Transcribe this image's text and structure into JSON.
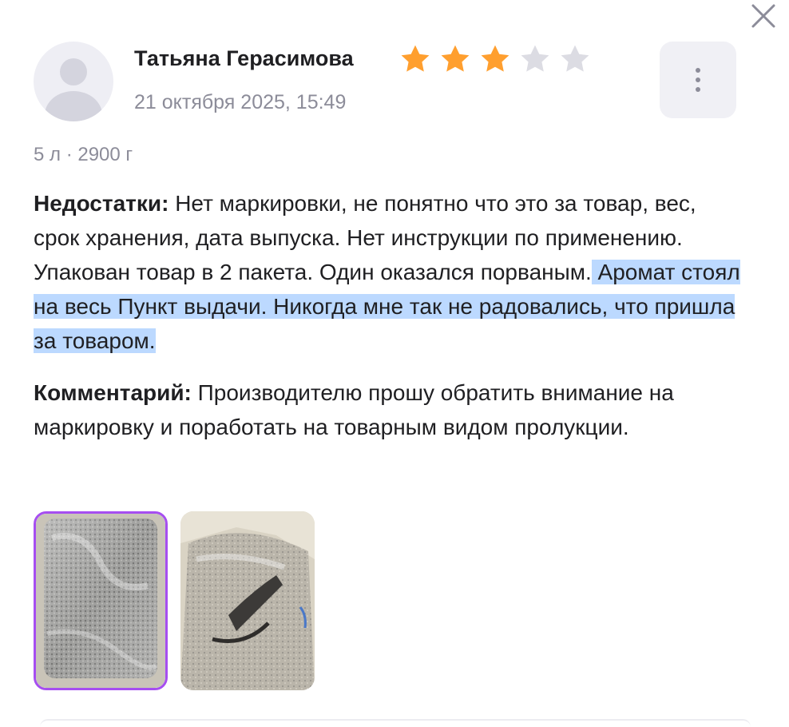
{
  "review": {
    "author": "Татьяна Герасимова",
    "date": "21 октября 2025, 15:49",
    "rating": 3,
    "rating_max": 5,
    "variant": "5 л · 2900 г",
    "cons_label": "Недостатки:",
    "cons_text_1": " Нет маркировки, не понятно что это за товар, вес, срок хранения, дата выпуска. Нет инструкции по применению. Упакован товар в 2 пакета. Один оказался порваным.",
    "cons_text_highlighted": " Аромат стоял на весь Пункт выдачи. Никогда мне так не радовались, что пришла за товаром.",
    "comment_label": "Комментарий:",
    "comment_text": " Производителю прошу обратить внимание на маркировку и поработать на товарным видом пролукции."
  },
  "colors": {
    "star_filled": "#ff9f2f",
    "star_empty": "#dcdce3",
    "highlight": "#bcd9ff",
    "selected_thumb_border": "#a64ef0"
  },
  "icons": {
    "close": "close-icon",
    "more": "more-vertical-icon",
    "avatar": "user-avatar-icon",
    "star": "star-icon"
  }
}
